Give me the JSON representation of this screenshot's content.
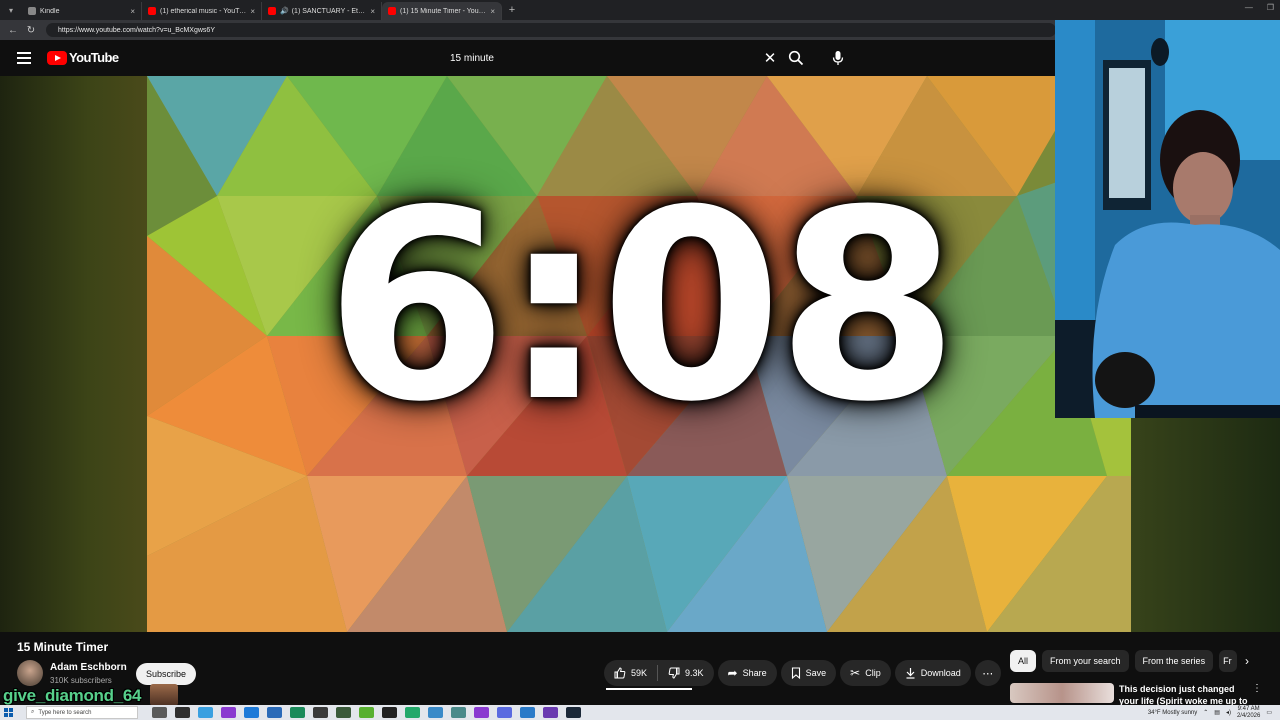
{
  "browser": {
    "tabs": [
      {
        "title": "Kindle",
        "close": "×"
      },
      {
        "title": "(1) etherical music - YouTube",
        "close": "×"
      },
      {
        "title": "(1) SANCTUARY - Ethereal Ar",
        "close": "×"
      },
      {
        "title": "(1) 15 Minute Timer - YouTube",
        "close": "×"
      }
    ],
    "new_tab": "+",
    "url": "https://www.youtube.com/watch?v=u_BcMXgws6Y"
  },
  "youtube": {
    "logo_text": "YouTube",
    "search_query": "15 minute",
    "clear": "✕"
  },
  "player": {
    "timer_text": "6:08"
  },
  "video": {
    "title": "15 Minute Timer",
    "channel": "Adam Eschborn",
    "subscribers": "310K subscribers",
    "subscribe_label": "Subscribe",
    "likes": "59K",
    "dislikes": "9.3K",
    "share": "Share",
    "save": "Save",
    "clip": "Clip",
    "download": "Download",
    "more": "⋯"
  },
  "filters": {
    "chips": [
      "All",
      "From your search",
      "From the series",
      "Fr"
    ],
    "next": "›"
  },
  "recommendation": {
    "title": "This decision just changed your life (Spirit woke me up to deliv"
  },
  "overlay": {
    "chat_username": "give_diamond_64"
  },
  "taskbar": {
    "search_placeholder": "Type here to search",
    "weather": "34°F  Mostly sunny",
    "time": "9:47 AM",
    "date": "2/4/2026"
  },
  "colors": {
    "yt_red": "#ff0000",
    "chat_green": "#57d08b",
    "background": "#0f0f0f"
  }
}
